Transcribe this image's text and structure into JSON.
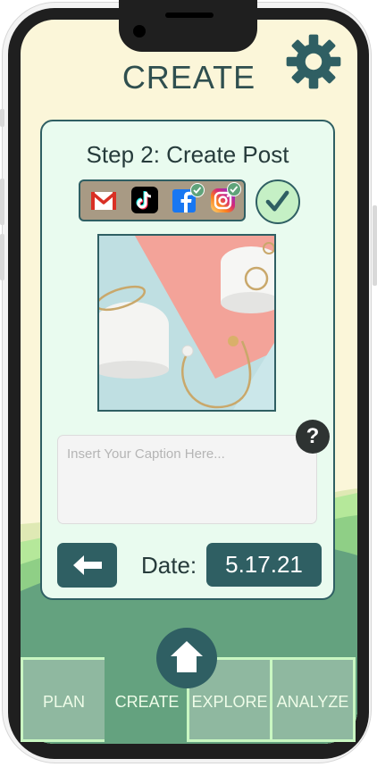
{
  "header": {
    "title": "CREATE"
  },
  "card": {
    "step_title": "Step 2: Create Post",
    "caption_placeholder": "Insert Your Caption Here...",
    "help_label": "?",
    "date_label": "Date:",
    "date_value": "5.17.21"
  },
  "social": [
    {
      "name": "Gmail",
      "icon": "gmail-icon",
      "checked": false
    },
    {
      "name": "TikTok",
      "icon": "tiktok-icon",
      "checked": false
    },
    {
      "name": "Facebook",
      "icon": "facebook-icon",
      "checked": true
    },
    {
      "name": "Instagram",
      "icon": "instagram-icon",
      "checked": true
    }
  ],
  "nav": {
    "tabs": [
      {
        "label": "PLAN",
        "active": false
      },
      {
        "label": "CREATE",
        "active": true
      },
      {
        "label": "EXPLORE",
        "active": false
      },
      {
        "label": "ANALYZE",
        "active": false
      }
    ]
  },
  "colors": {
    "accent": "#2f5f63",
    "card_bg": "#e9fbef",
    "screen_bg": "#fbf6d9",
    "hill_dark": "#64a27f",
    "hill_light": "#b5e89a",
    "tab_border": "#c9f7c2"
  }
}
